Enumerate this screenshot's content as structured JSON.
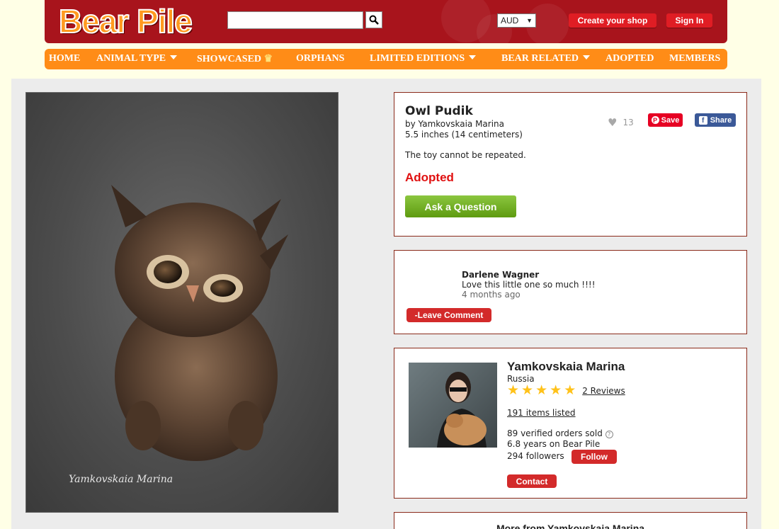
{
  "header": {
    "logo": "Bear Pile",
    "search": {
      "placeholder": "",
      "value": ""
    },
    "currency": "AUD",
    "create_shop": "Create your shop",
    "sign_in": "Sign In"
  },
  "nav": [
    {
      "label": "HOME",
      "dropdown": false
    },
    {
      "label": "ANIMAL TYPE",
      "dropdown": true
    },
    {
      "label": "SHOWCASED",
      "dropdown": false
    },
    {
      "label": "ORPHANS",
      "dropdown": false
    },
    {
      "label": "LIMITED EDITIONS",
      "dropdown": true
    },
    {
      "label": "BEAR RELATED",
      "dropdown": true
    },
    {
      "label": "ADOPTED",
      "dropdown": false
    },
    {
      "label": "MEMBERS",
      "dropdown": false
    }
  ],
  "photo": {
    "watermark": "Yamkovskaia Marina"
  },
  "product": {
    "title": "Owl Pudik",
    "artist_line": "by Yamkovskaia Marina",
    "size": "5.5 inches (14 centimeters)",
    "likes": "13",
    "save_label": "Save",
    "share_label": "Share",
    "description": "The toy cannot be repeated.",
    "status": "Adopted",
    "ask_button": "Ask a Question"
  },
  "comments": {
    "items": [
      {
        "author": "Darlene Wagner",
        "text": "Love this little one so much !!!!",
        "time": "4 months ago"
      }
    ],
    "leave_comment": "-Leave Comment"
  },
  "seller": {
    "name": "Yamkovskaia Marina",
    "country": "Russia",
    "rating": 5,
    "reviews": "2 Reviews",
    "items_listed": "191 items listed",
    "orders_sold": "89 verified orders sold",
    "years": "6.8 years on Bear Pile",
    "followers": "294 followers",
    "follow_button": "Follow",
    "contact_button": "Contact"
  },
  "more_from": {
    "title": "More from Yamkovskaia Marina"
  },
  "colors": {
    "header": "#a8141c",
    "nav": "#ff8c17",
    "accent_red": "#d32a2a",
    "adopted": "#e01010",
    "green": "#6aad1e",
    "star": "#ffc21a"
  }
}
